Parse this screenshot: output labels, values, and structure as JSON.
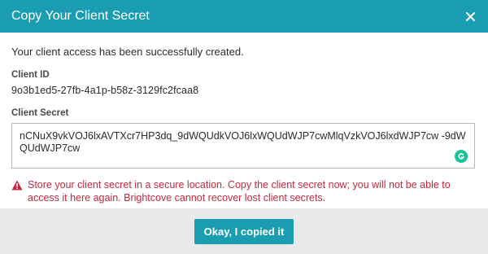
{
  "dialog": {
    "title": "Copy Your Client Secret",
    "close_icon": "close-icon",
    "intro": "Your client access has been successfully created.",
    "client_id": {
      "label": "Client ID",
      "value": "9o3b1ed5-27fb-4a1p-b58z-3129fc2fcaa8"
    },
    "client_secret": {
      "label": "Client Secret",
      "value": "nCNuX9vkVOJ6lxAVTXcr7HP3dq_9dWQUdkVOJ6lxWQUdWJP7cwMlqVzkVOJ6lxdWJP7cw -9dWQUdWJP7cw",
      "extension_icon": "grammarly-icon"
    },
    "warning": {
      "icon": "warning-icon",
      "text": "Store your client secret in a secure location. Copy the client secret now; you will not be able to access it here again. Brightcove cannot recover lost client secrets."
    },
    "confirm_label": "Okay, I copied it"
  },
  "colors": {
    "header_bg": "#1a9db0",
    "button_bg": "#1a9db0",
    "warning_text": "#c3283c",
    "footer_bg": "#e9e9e9"
  }
}
